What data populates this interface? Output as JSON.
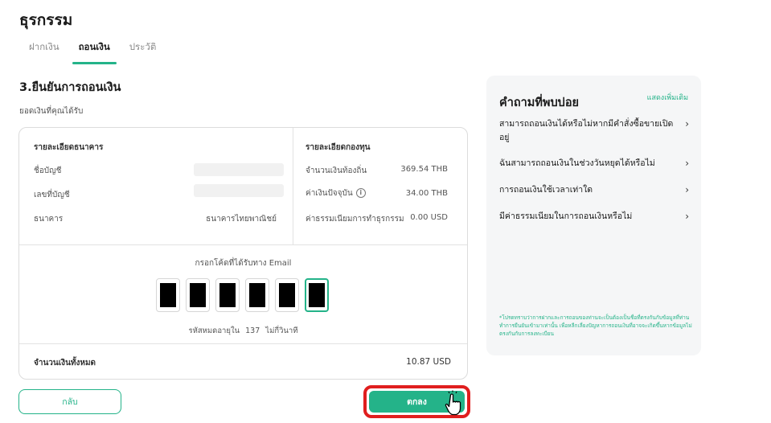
{
  "page": {
    "title": "ธุรกรรม"
  },
  "tabs": [
    {
      "label": "ฝากเงิน",
      "active": false
    },
    {
      "label": "ถอนเงิน",
      "active": true
    },
    {
      "label": "ประวัติ",
      "active": false
    }
  ],
  "step": {
    "title": "3.ยืนยันการถอนเงิน",
    "receive_label": "ยอดเงินที่คุณได้รับ"
  },
  "bank": {
    "heading": "รายละเอียดธนาคาร",
    "account_name_label": "ชื่อบัญชี",
    "account_number_label": "เลขที่บัญชี",
    "bank_label": "ธนาคาร",
    "bank_value": "ธนาคารไทยพาณิชย์"
  },
  "fund": {
    "heading": "รายละเอียดกองทุน",
    "local_amount_label": "จำนวนเงินท้องถิ่น",
    "local_amount_value": "369.54 THB",
    "current_value_label": "ค่าเงินปัจจุบัน",
    "current_value_value": "34.00 THB",
    "info_glyph": "i",
    "fee_label": "ค่าธรรมเนียมการทำธุรกรรม",
    "fee_value": "0.00 USD"
  },
  "otp": {
    "label": "กรอกโค้ดที่ได้รับทาง Email",
    "digit_count": 6,
    "focused_index": 5,
    "timer_prefix": "รหัสหมดอายุใน",
    "timer_seconds": "137",
    "timer_suffix": "ไม่กี่วินาที"
  },
  "total": {
    "label": "จำนวนเงินทั้งหมด",
    "value": "10.87 USD"
  },
  "buttons": {
    "back_label": "กลับ",
    "confirm_label": "ตกลง"
  },
  "faq": {
    "title": "คำถามที่พบบ่อย",
    "more_label": "แสดงเพิ่มเติม",
    "items": [
      "สามารถถอนเงินได้หรือไม่หากมีคำสั่งซื้อขายเปิดอยู่",
      "ฉันสามารถถอนเงินในช่วงวันหยุดได้หรือไม่",
      "การถอนเงินใช้เวลาเท่าใด",
      "มีค่าธรรมเนียมในการถอนเงินหรือไม่"
    ],
    "chevron": "›",
    "note": "*โปรดทราบว่าการฝากและการถอนของท่านจะเป็นต้องเป็นชื่อที่ตรงกันกับข้อมูลที่ท่านทำการยืนยันเข้ามาเท่านั้น เพื่อหลีกเลี่ยงปัญหาการถอนเงินที่อาจจะเกิดขึ้นหากข้อมูลไม่ตรงกันกับการลงทะเบียน"
  },
  "colors": {
    "accent": "#24b389",
    "highlight": "#e01e1e"
  },
  "icons": {
    "cursor": "pointing-hand-icon"
  }
}
